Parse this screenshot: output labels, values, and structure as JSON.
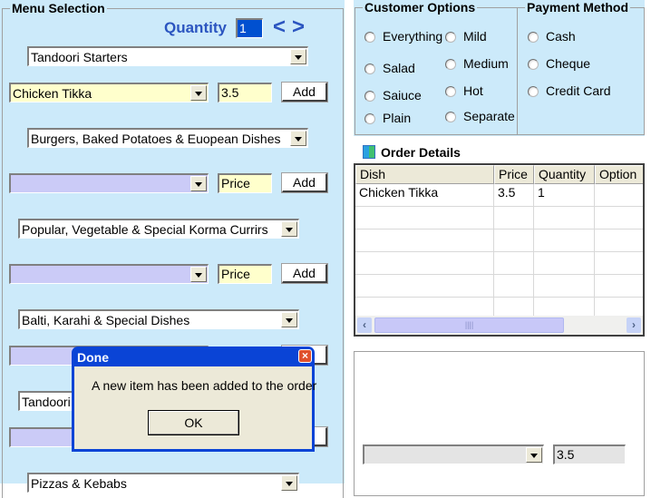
{
  "menu_selection": {
    "title": "Menu Selection",
    "quantity_label": "Quantity",
    "quantity_value": "1",
    "prev_symbol": "<",
    "next_symbol": ">",
    "sections": [
      {
        "category": "Tandoori Starters",
        "dish": "Chicken Tikka",
        "price": "3.5",
        "add_label": "Add"
      },
      {
        "category": "Burgers, Baked Potatoes & Euopean Dishes",
        "dish": "",
        "price": "Price",
        "add_label": "Add"
      },
      {
        "category": "Popular, Vegetable &  Special Korma Currirs",
        "dish": "",
        "price": "Price",
        "add_label": "Add"
      },
      {
        "category": "Balti, Karahi & Special Dishes",
        "dish": "",
        "price": "",
        "add_label": ""
      },
      {
        "category": "Tandoori",
        "dish": "",
        "price": "",
        "add_label": ""
      },
      {
        "category": "Pizzas & Kebabs"
      }
    ]
  },
  "customer_options": {
    "title": "Customer  Options",
    "col1": [
      "Everything",
      "Salad",
      "Saiuce",
      "Plain"
    ],
    "col2": [
      "Mild",
      "Medium",
      "Hot",
      "Separate"
    ]
  },
  "payment_method": {
    "title": "Payment Method",
    "options": [
      "Cash",
      "Cheque",
      "Credit Card"
    ]
  },
  "order_details": {
    "title": "Order Details",
    "columns": [
      "Dish",
      "Price",
      "Quantity",
      "Option"
    ],
    "rows": [
      [
        "Chicken Tikka",
        "3.5",
        "1",
        ""
      ]
    ],
    "empty_rows": 7
  },
  "bottom_panel": {
    "combo_value": "",
    "price_value": "3.5"
  },
  "dialog": {
    "title": "Done",
    "message": "A new item has been added to the order",
    "ok_label": "OK"
  },
  "colors": {
    "panel_bg": "#cceafa",
    "accent_blue": "#2b55c0",
    "lavender": "#cbcbf7",
    "yellow": "#ffffcc",
    "dialog_title": "#0a44d6"
  }
}
